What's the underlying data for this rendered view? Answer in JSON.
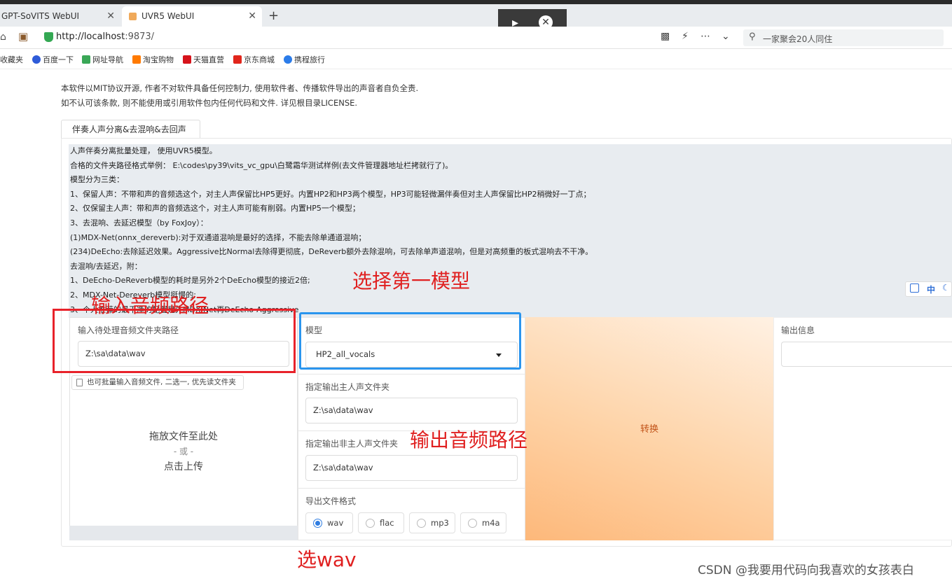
{
  "browser": {
    "tabs": [
      {
        "label": "GPT-SoVITS WebUI",
        "close": "✕"
      },
      {
        "label": "UVR5 WebUI",
        "close": "✕"
      }
    ],
    "new_tab": "+",
    "url_host": "http://localhost",
    "url_port": ":9873/",
    "search_placeholder": "一家聚会20人同住",
    "bookmarks": [
      {
        "label": "收藏夹",
        "color": "#ffffff"
      },
      {
        "label": "百度一下",
        "color": "#2e5bd8"
      },
      {
        "label": "网址导航",
        "color": "#3aa757"
      },
      {
        "label": "淘宝购物",
        "color": "#ff7a00"
      },
      {
        "label": "天猫直营",
        "color": "#d6131b"
      },
      {
        "label": "京东商城",
        "color": "#e1251b"
      },
      {
        "label": "携程旅行",
        "color": "#2b7ce9"
      }
    ]
  },
  "page": {
    "notice_line1": "本软件以MIT协议开源, 作者不对软件具备任何控制力, 使用软件者、传播软件导出的声音者自负全责.",
    "notice_line2": "如不认可该条款, 则不能使用或引用软件包内任何代码和文件. 详见根目录LICENSE.",
    "tab_label": "伴奏人声分离&去混响&去回声",
    "description": [
      "人声伴奏分离批量处理， 使用UVR5模型。",
      "合格的文件夹路径格式举例： E:\\codes\\py39\\vits_vc_gpu\\白鹭霜华测试样例(去文件管理器地址栏拷就行了)。",
      "模型分为三类：",
      "1、保留人声：不带和声的音频选这个，对主人声保留比HP5更好。内置HP2和HP3两个模型，HP3可能轻微漏伴奏但对主人声保留比HP2稍微好一丁点；",
      "2、仅保留主人声：带和声的音频选这个，对主人声可能有削弱。内置HP5一个模型；",
      "3、去混响、去延迟模型（by FoxJoy）：",
      "      (1)MDX-Net(onnx_dereverb):对于双通道混响是最好的选择，不能去除单通道混响；",
      "   (234)DeEcho:去除延迟效果。Aggressive比Normal去除得更彻底，DeReverb额外去除混响，可去除单声道混响，但是对高频重的板式混响去不干净。",
      "去混响/去延迟，附：",
      "1、DeEcho-DeReverb模型的耗时是另外2个DeEcho模型的接近2倍;",
      "2、MDX-Net-Dereverb模型挺慢的;",
      "3、个人推荐的最干净的配置是先MDX-Net再DeEcho-Aggressive"
    ],
    "input_dir_label": "输入待处理音频文件夹路径",
    "input_dir_value": "Z:\\sa\\data\\wav",
    "file_upload_label": "也可批量输入音频文件, 二选一, 优先读文件夹",
    "drop_text": "拖放文件至此处",
    "drop_or": "- 或 -",
    "drop_click": "点击上传",
    "model_label": "模型",
    "model_value": "HP2_all_vocals",
    "vocal_out_label": "指定输出主人声文件夹",
    "vocal_out_value": "Z:\\sa\\data\\wav",
    "inst_out_label": "指定输出非主人声文件夹",
    "inst_out_value": "Z:\\sa\\data\\wav",
    "format_label": "导出文件格式",
    "formats": [
      "wav",
      "flac",
      "mp3",
      "m4a"
    ],
    "format_selected": "wav",
    "convert_label": "转换",
    "output_info_label": "输出信息",
    "side_tools_lang": "中"
  },
  "annotations": {
    "input_path": "输入音频路径",
    "select_model": "选择第一模型",
    "output_path": "输出音频路径",
    "select_wav": "选wav",
    "red": "#e02020",
    "blue": "#2a95ee"
  },
  "watermark": "CSDN @我要用代码向我喜欢的女孩表白"
}
